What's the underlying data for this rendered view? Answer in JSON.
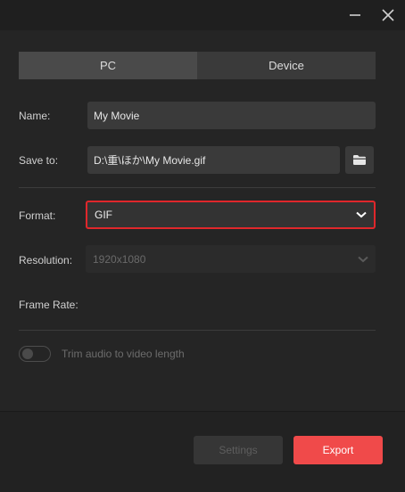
{
  "window": {
    "minimize_icon": "minimize-icon",
    "close_icon": "close-icon"
  },
  "tabs": [
    {
      "label": "PC",
      "active": true
    },
    {
      "label": "Device",
      "active": false
    }
  ],
  "name": {
    "label": "Name:",
    "value": "My Movie"
  },
  "save_to": {
    "label": "Save to:",
    "value": "D:\\重\\ほか\\My Movie.gif",
    "browse_icon": "folder-icon"
  },
  "format": {
    "label": "Format:",
    "value": "GIF",
    "highlight_color": "#e0272b"
  },
  "resolution": {
    "label": "Resolution:",
    "value": "1920x1080",
    "disabled": true
  },
  "frame_rate": {
    "label": "Frame Rate:"
  },
  "trim_audio": {
    "label": "Trim audio to video length",
    "enabled": false
  },
  "buttons": {
    "settings": "Settings",
    "export": "Export",
    "export_color": "#f04a4a"
  }
}
